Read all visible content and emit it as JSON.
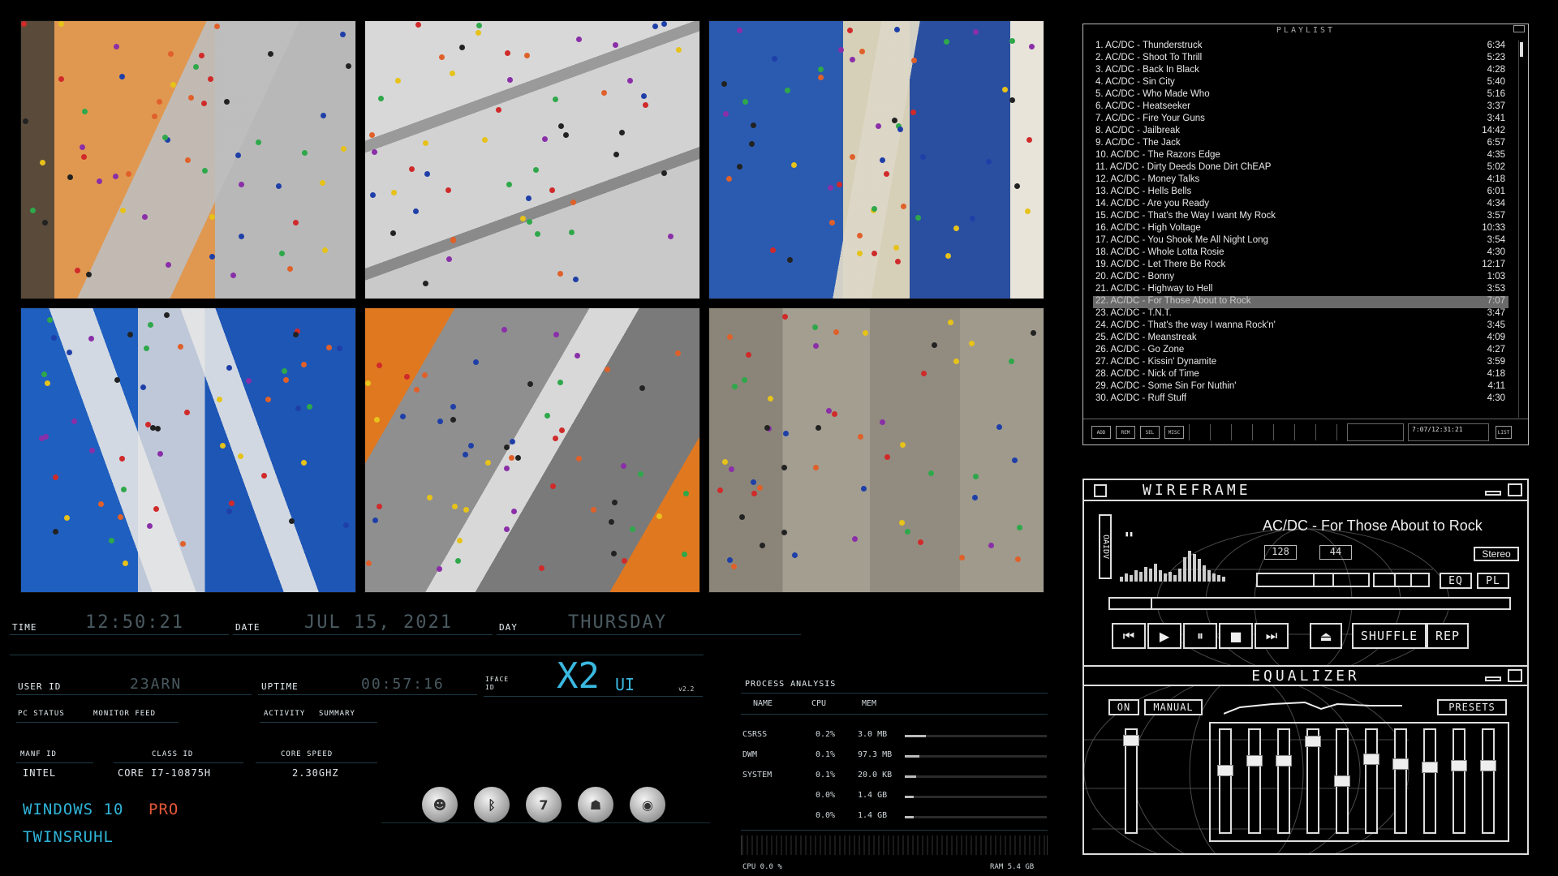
{
  "hud": {
    "time_label": "TIME",
    "time_value": "12:50:21",
    "date_label": "DATE",
    "date_value": "JUL 15, 2021",
    "day_label": "DAY",
    "day_value": "THURSDAY",
    "user_label": "USER ID",
    "user_value": "23ARN",
    "uptime_label": "UPTIME",
    "uptime_value": "00:57:16",
    "iface_label": "IFACE ID",
    "logo": "X2",
    "logo_suffix": "UI",
    "version": "v2.2",
    "pc_status": "PC STATUS",
    "monitor_feed": "MONITOR FEED",
    "activity": "ACTIVITY",
    "summary": "SUMMARY",
    "manf_label": "MANF ID",
    "manf_value": "INTEL",
    "class_label": "CLASS ID",
    "class_value": "CORE I7-10875H",
    "speed_label": "CORE SPEED",
    "speed_value": "2.30GHZ",
    "os_part1": "WINDOWS 10",
    "os_part2": "PRO",
    "hostname": "TWINSRUHL",
    "apps": [
      {
        "icon": "mask-icon",
        "glyph": "☻"
      },
      {
        "icon": "bluetooth-icon",
        "glyph": "ᛒ"
      },
      {
        "icon": "calendar-icon",
        "glyph": "7"
      },
      {
        "icon": "android-icon",
        "glyph": "☗"
      },
      {
        "icon": "gamepad-icon",
        "glyph": "◉"
      }
    ]
  },
  "process": {
    "title": "PROCESS ANALYSIS",
    "headers": [
      "NAME",
      "CPU",
      "MEM"
    ],
    "rows": [
      {
        "name": "CSRSS",
        "cpu": "0.2%",
        "mem": "3.0 MB",
        "level": 0.15
      },
      {
        "name": "DWM",
        "cpu": "0.1%",
        "mem": "97.3 MB",
        "level": 0.1
      },
      {
        "name": "SYSTEM",
        "cpu": "0.1%",
        "mem": "20.0 KB",
        "level": 0.08
      },
      {
        "name": "",
        "cpu": "0.0%",
        "mem": "1.4 GB",
        "level": 0.06
      },
      {
        "name": "",
        "cpu": "0.0%",
        "mem": "1.4 GB",
        "level": 0.06
      }
    ],
    "cpu_footer": "CPU 0.0 %",
    "ram_footer": "RAM 5.4 GB"
  },
  "playlist": {
    "title": "PLAYLIST",
    "selected_index": 21,
    "tracks": [
      {
        "title": "1. AC/DC - Thunderstruck",
        "time": "6:34"
      },
      {
        "title": "2. AC/DC - Shoot To Thrill",
        "time": "5:23"
      },
      {
        "title": "3. AC/DC - Back In Black",
        "time": "4:28"
      },
      {
        "title": "4. AC/DC - Sin City",
        "time": "5:40"
      },
      {
        "title": "5. AC/DC - Who Made Who",
        "time": "5:16"
      },
      {
        "title": "6. AC/DC - Heatseeker",
        "time": "3:37"
      },
      {
        "title": "7. AC/DC - Fire Your Guns",
        "time": "3:41"
      },
      {
        "title": "8. AC/DC - Jailbreak",
        "time": "14:42"
      },
      {
        "title": "9. AC/DC - The Jack",
        "time": "6:57"
      },
      {
        "title": "10. AC/DC - The Razors Edge",
        "time": "4:35"
      },
      {
        "title": "11. AC/DC - Dirty Deeds Done Dirt ChEAP",
        "time": "5:02"
      },
      {
        "title": "12. AC/DC - Money Talks",
        "time": "4:18"
      },
      {
        "title": "13. AC/DC - Hells Bells",
        "time": "6:01"
      },
      {
        "title": "14. AC/DC - Are you Ready",
        "time": "4:34"
      },
      {
        "title": "15. AC/DC - That's the Way I want My Rock",
        "time": "3:57"
      },
      {
        "title": "16. AC/DC - High Voltage",
        "time": "10:33"
      },
      {
        "title": "17. AC/DC - You Shook Me All Night Long",
        "time": "3:54"
      },
      {
        "title": "18. AC/DC - Whole Lotta Rosie",
        "time": "4:30"
      },
      {
        "title": "19. AC/DC - Let There Be Rock",
        "time": "12:17"
      },
      {
        "title": "20. AC/DC - Bonny",
        "time": "1:03"
      },
      {
        "title": "21. AC/DC - Highway to Hell",
        "time": "3:53"
      },
      {
        "title": "22. AC/DC - For Those About to Rock",
        "time": "7:07"
      },
      {
        "title": "23. AC/DC - T.N.T.",
        "time": "3:47"
      },
      {
        "title": "24. AC/DC - That's the way I wanna Rock'n'",
        "time": "3:45"
      },
      {
        "title": "25. AC/DC - Meanstreak",
        "time": "4:09"
      },
      {
        "title": "26. AC/DC - Go Zone",
        "time": "4:27"
      },
      {
        "title": "27. AC/DC - Kissin' Dynamite",
        "time": "3:59"
      },
      {
        "title": "28. AC/DC - Nick of Time",
        "time": "4:18"
      },
      {
        "title": "29. AC/DC - Some Sin For Nuthin'",
        "time": "4:11"
      },
      {
        "title": "30. AC/DC - Ruff Stuff",
        "time": "4:30"
      }
    ],
    "buttons": [
      "ADD",
      "REM",
      "SEL",
      "MISC"
    ],
    "time_display": "7:07/12:31:21",
    "list_button": "LIST"
  },
  "player": {
    "title": "WIREFRAME",
    "vis_letters": "OAIDV",
    "song": "AC/DC - For Those About to Rock",
    "kbps": "128",
    "khz": "44",
    "stereo": "Stereo",
    "eq_btn": "EQ",
    "pl_btn": "PL",
    "seek_position": 0.1,
    "volume": 0.6,
    "balance": 0.5,
    "shuffle": "SHUFFLE",
    "repeat": "REP",
    "controls": [
      {
        "name": "prev-button",
        "glyph": "⏮"
      },
      {
        "name": "play-button",
        "glyph": "▶"
      },
      {
        "name": "pause-button",
        "glyph": "⏸"
      },
      {
        "name": "stop-button",
        "glyph": "■"
      },
      {
        "name": "next-button",
        "glyph": "⏭"
      }
    ],
    "eject_glyph": "⏏"
  },
  "equalizer": {
    "title": "EQUALIZER",
    "on": "ON",
    "manual": "MANUAL",
    "presets": "PRESETS",
    "preamp": 0.05,
    "bands": [
      0.38,
      0.28,
      0.28,
      0.06,
      0.5,
      0.26,
      0.31,
      0.35,
      0.33,
      0.33
    ]
  },
  "colors": {
    "accent": "#2fb5d8",
    "pro": "#e5593a",
    "logo": "#3ab8e0"
  }
}
